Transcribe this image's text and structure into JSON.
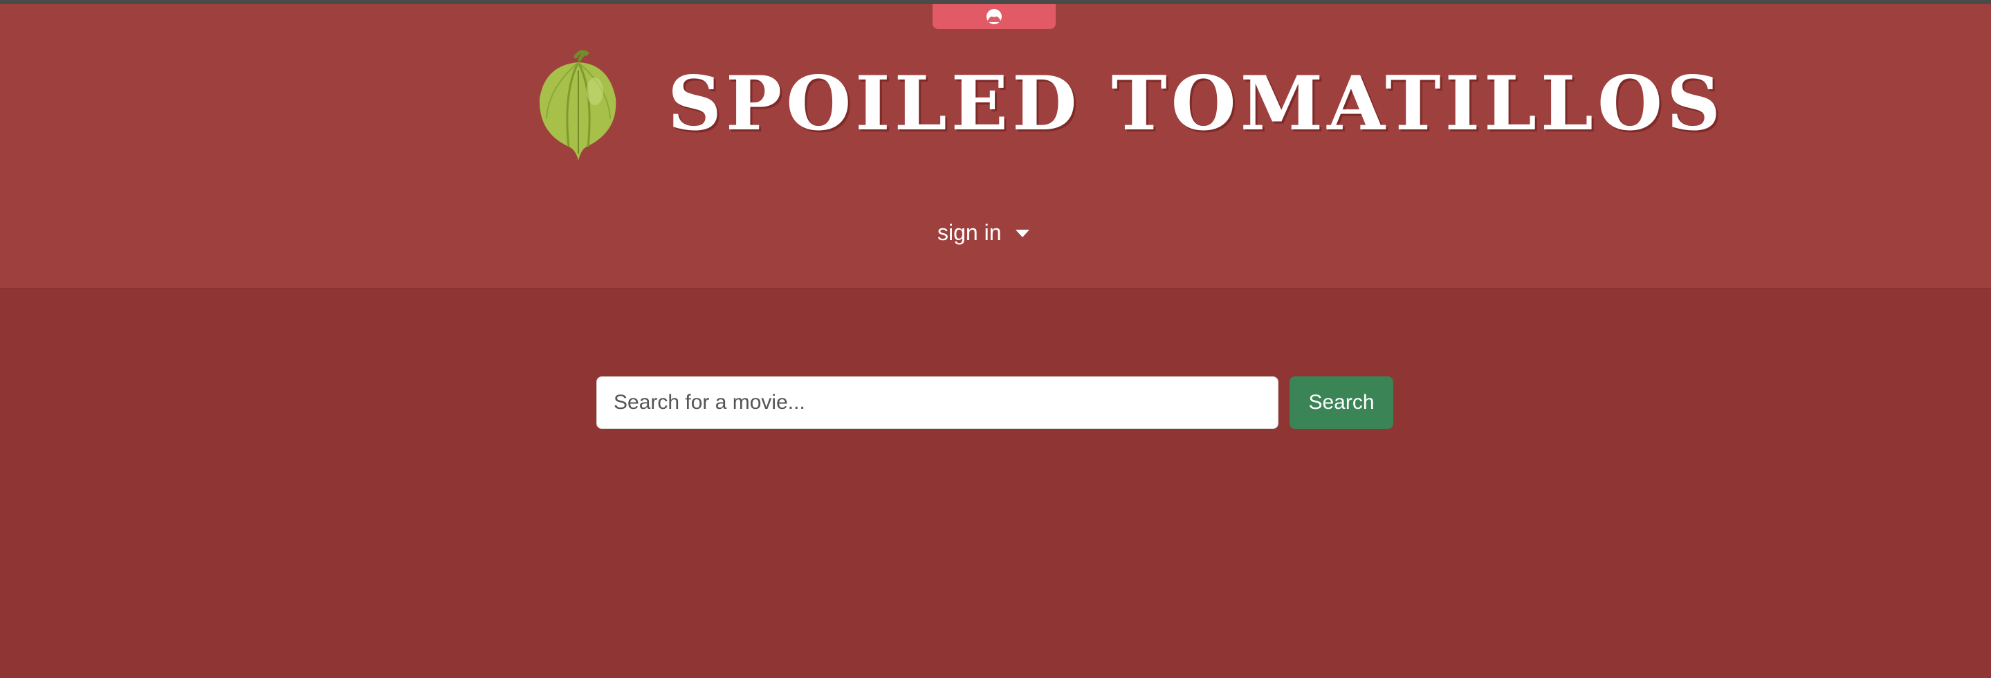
{
  "header": {
    "site_title": "SPOILED TOMATILLOS",
    "logo_icon": "tomatillo-icon",
    "handle_icon": "wave-icon",
    "signin_label": "sign in"
  },
  "search": {
    "placeholder": "Search for a movie...",
    "value": "",
    "button_label": "Search"
  },
  "colors": {
    "header_bg": "#9d403e",
    "page_bg": "#8f3634",
    "handle_bg": "#e15a66",
    "button_bg": "#3a8456"
  }
}
